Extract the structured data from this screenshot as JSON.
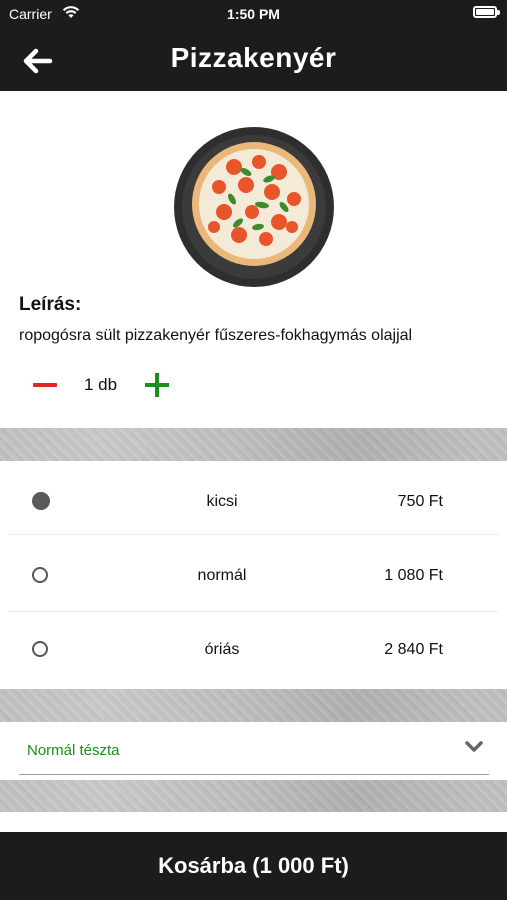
{
  "status_bar": {
    "carrier": "Carrier",
    "time": "1:50 PM"
  },
  "header": {
    "title": "Pizzakenyér",
    "back_icon": "arrow-left-icon"
  },
  "product": {
    "description_label": "Leírás:",
    "description": "ropogósra sült pizzakenyér fűszeres-fokhagymás olajjal"
  },
  "quantity": {
    "value": "1 db",
    "minus_icon": "minus-icon",
    "plus_icon": "plus-icon"
  },
  "sizes": [
    {
      "name": "kicsi",
      "price": "750 Ft",
      "selected": true
    },
    {
      "name": "normál",
      "price": "1 080 Ft",
      "selected": false
    },
    {
      "name": "óriás",
      "price": "2 840 Ft",
      "selected": false
    }
  ],
  "dough": {
    "selected": "Normál tészta",
    "icon": "chevron-down-icon"
  },
  "cart_button": {
    "label": "Kosárba (1 000 Ft)"
  },
  "colors": {
    "bar": "#1c1c1c",
    "accent_green": "#1a8f1a",
    "accent_red": "#e02424"
  }
}
